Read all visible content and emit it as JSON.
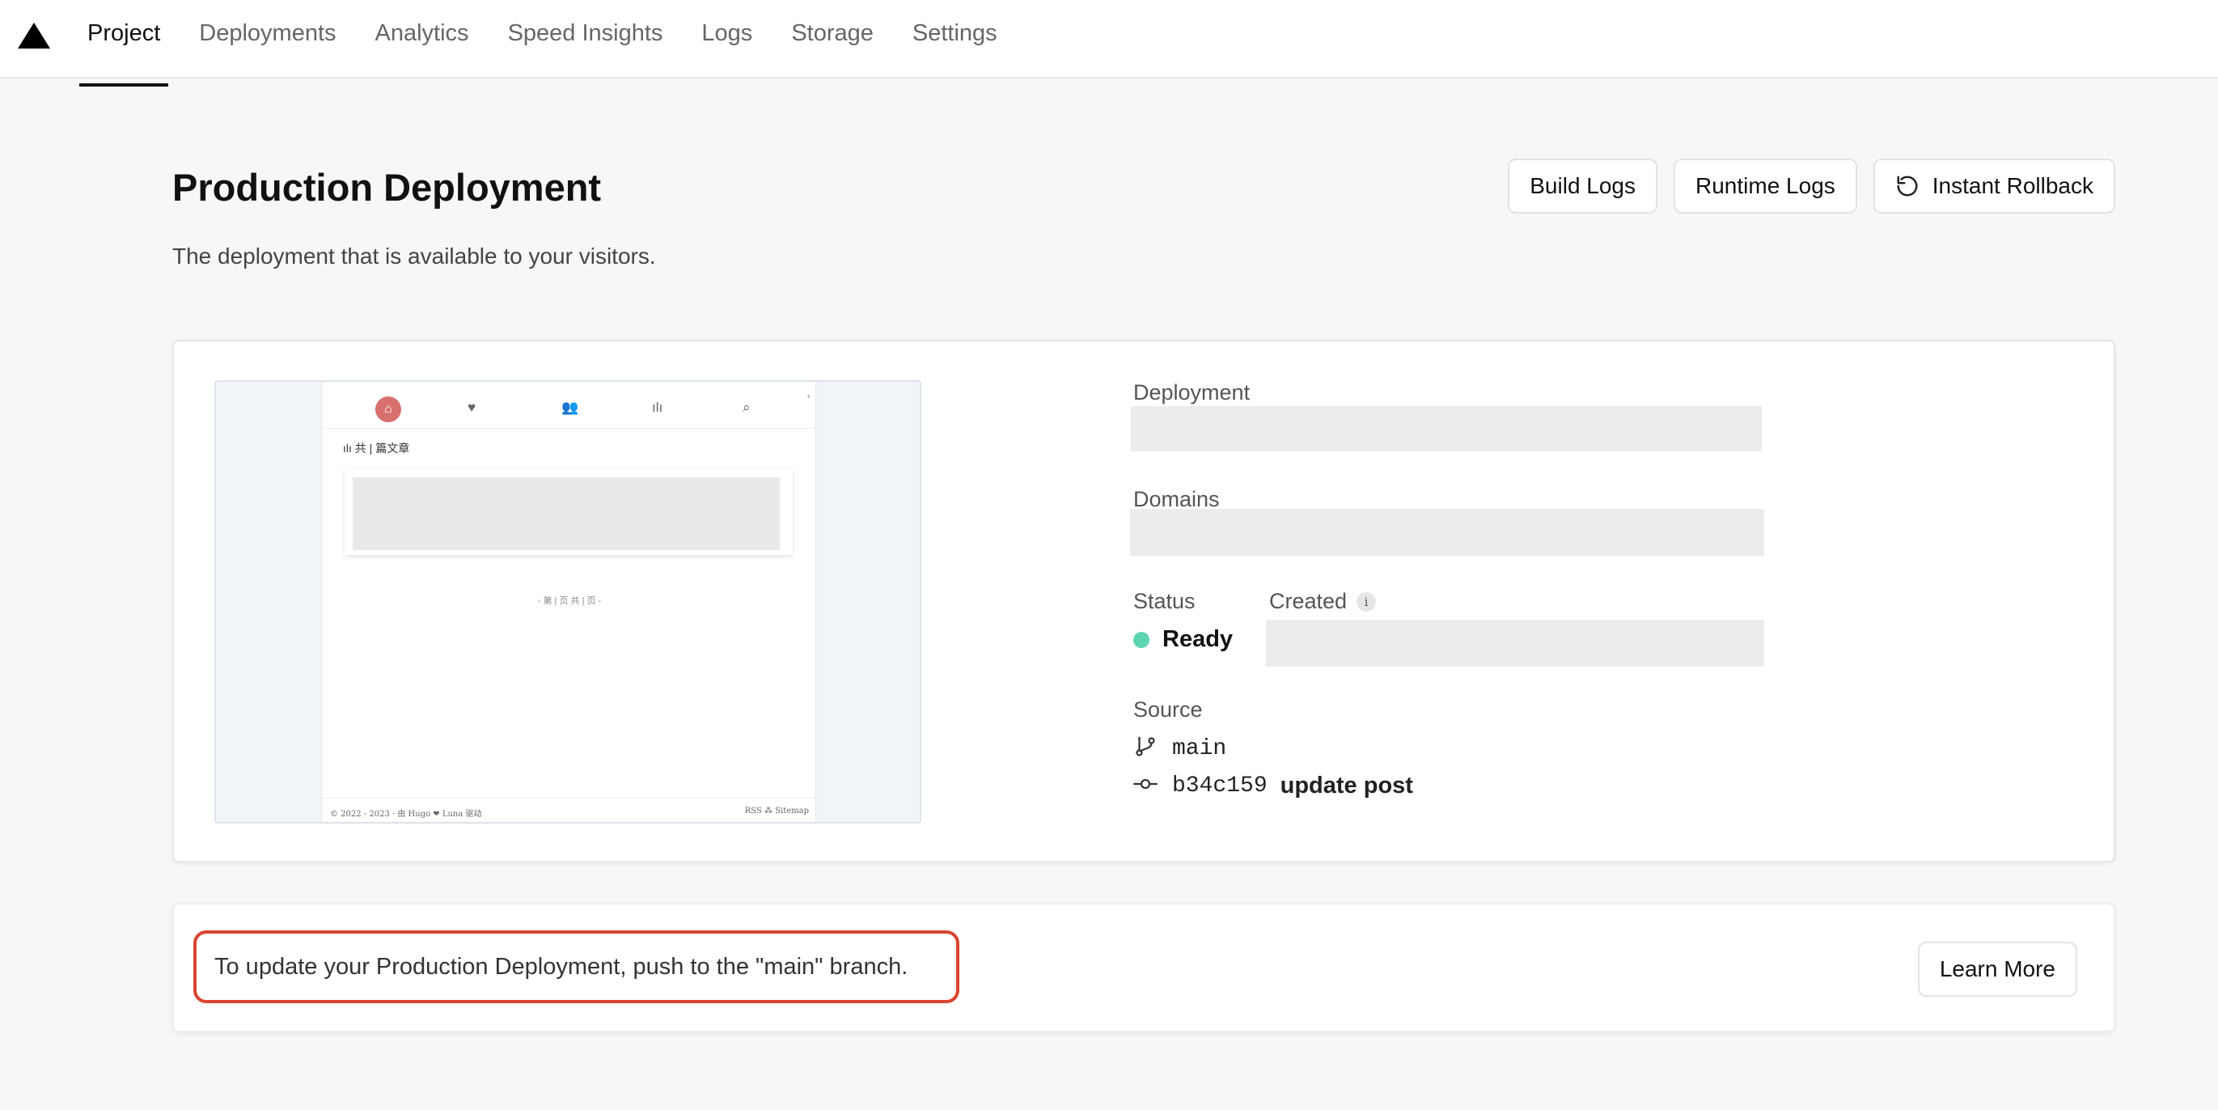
{
  "nav": {
    "logo": "triangle-logo",
    "tabs": [
      {
        "label": "Project",
        "active": true
      },
      {
        "label": "Deployments"
      },
      {
        "label": "Analytics"
      },
      {
        "label": "Speed Insights"
      },
      {
        "label": "Logs"
      },
      {
        "label": "Storage"
      },
      {
        "label": "Settings"
      }
    ]
  },
  "header": {
    "title": "Production Deployment",
    "subtitle": "The deployment that is available to your visitors.",
    "buttons": {
      "build_logs": "Build Logs",
      "runtime_logs": "Runtime Logs",
      "instant_rollback": "Instant Rollback"
    }
  },
  "preview": {
    "post_count": "ılı 共 | 篇文章",
    "pager": "- 第 | 页 共 | 页 -",
    "footer_left": "© 2022 - 2023 · 由 Hugo ❤ Luna 驱动",
    "footer_right": "RSS ⁂ Sitemap"
  },
  "details": {
    "deployment_label": "Deployment",
    "domains_label": "Domains",
    "status_label": "Status",
    "status_value": "Ready",
    "status_color": "#5fd4b0",
    "created_label": "Created",
    "source_label": "Source",
    "branch": "main",
    "commit_hash": "b34c159",
    "commit_message": "update post"
  },
  "banner": {
    "message": "To update your Production Deployment, push to the \"main\" branch.",
    "learn_more": "Learn More",
    "highlight_color": "#d9442f"
  }
}
